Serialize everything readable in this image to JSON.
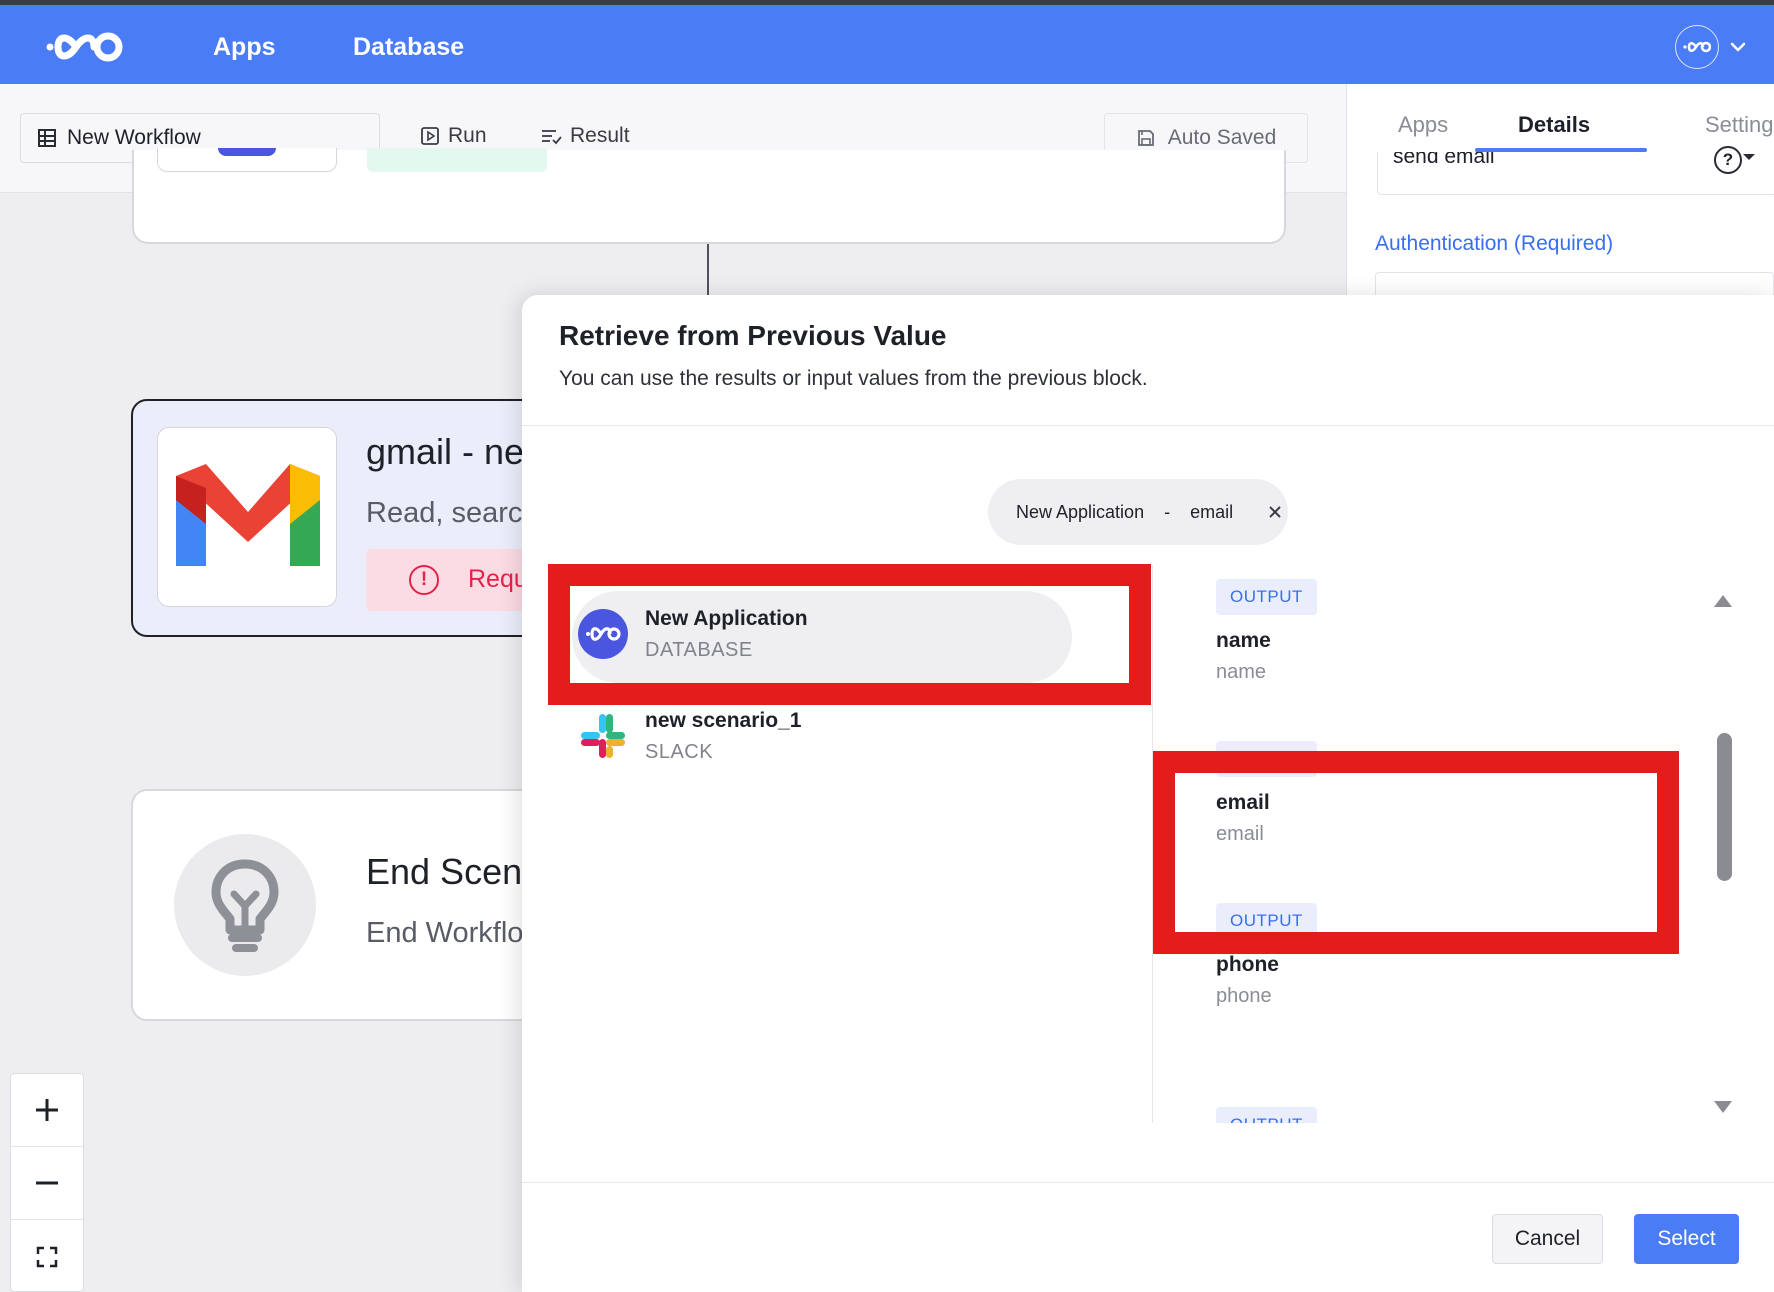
{
  "topbar": {
    "nav": [
      "Apps",
      "Database"
    ],
    "brand_color": "#4a7cf6"
  },
  "toolbar": {
    "workflow_name": "New Workflow",
    "run_label": "Run",
    "result_label": "Result",
    "autosave_label": "Auto Saved"
  },
  "right_panel": {
    "tabs": [
      "Apps",
      "Details",
      "Setting"
    ],
    "active_tab": "Details",
    "action_value": "send email",
    "auth_label": "Authentication (Required)"
  },
  "canvas": {
    "gmail_node": {
      "title": "gmail - ne",
      "subtitle": "Read, searc",
      "required_label": "Requ"
    },
    "end_node": {
      "title": "End Scen",
      "subtitle": "End Workflo"
    }
  },
  "modal": {
    "title": "Retrieve from Previous Value",
    "subtitle": "You can use the results or input values from the previous block.",
    "selected_chip": {
      "source": "New Application",
      "separator": "-",
      "field": "email"
    },
    "sources": [
      {
        "name": "New Application",
        "type": "DATABASE"
      },
      {
        "name": "new scenario_1",
        "type": "SLACK"
      }
    ],
    "outputs": [
      {
        "badge": "OUTPUT",
        "name": "name",
        "desc": "name"
      },
      {
        "badge": "OUTPUT",
        "name": "email",
        "desc": "email"
      },
      {
        "badge": "OUTPUT",
        "name": "phone",
        "desc": "phone"
      },
      {
        "badge": "OUTPUT",
        "name": "",
        "desc": ""
      }
    ],
    "cancel_label": "Cancel",
    "select_label": "Select"
  },
  "colors": {
    "accent": "#4a7cf6",
    "highlight": "#e51c1c",
    "error": "#e4234a"
  }
}
